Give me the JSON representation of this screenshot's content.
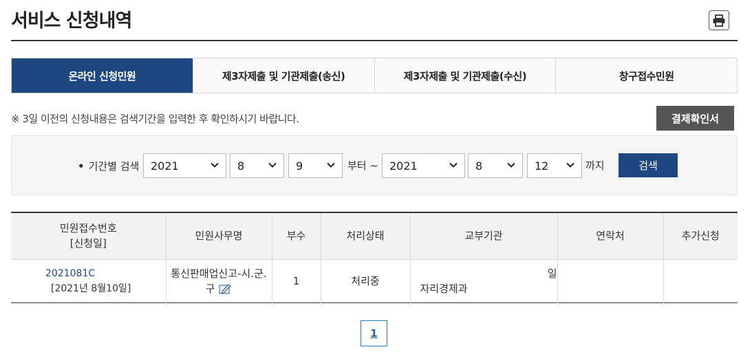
{
  "page": {
    "title": "서비스 신청내역",
    "print_icon": "printer-icon"
  },
  "tabs": [
    {
      "label": "온라인 신청민원",
      "active": true
    },
    {
      "label": "제3자제출 및 기관제출(송신)",
      "active": false
    },
    {
      "label": "제3자제출 및 기관제출(수신)",
      "active": false
    },
    {
      "label": "창구접수민원",
      "active": false
    }
  ],
  "notice": "※ 3일 이전의 신청내용은 검색기간을 입력한 후 확인하시기 바랍니다.",
  "confirm_button": "결제확인서",
  "search": {
    "label": "기간별 검색",
    "from_year": "2021",
    "from_month": "8",
    "from_day": "9",
    "from_word": "부터 ~",
    "to_year": "2021",
    "to_month": "8",
    "to_day": "12",
    "to_word": "까지",
    "button": "검색"
  },
  "table": {
    "headers": {
      "receipt_no": "민원접수번호",
      "receipt_date": "[신청일]",
      "name": "민원사무명",
      "copies": "부수",
      "status": "처리상태",
      "agency": "교부기관",
      "contact": "연락처",
      "additional": "추가신청"
    },
    "rows": [
      {
        "receipt_no": "2021081C",
        "date": "[2021년 8월10일]",
        "name_line1": "통신판매업신고-시.군.",
        "name_line2": "구",
        "attach_icon": "edit-document-icon",
        "copies": "1",
        "status": "처리중",
        "agency_line1": "일",
        "agency_line2": "자리경제과",
        "contact": "",
        "additional": ""
      }
    ]
  },
  "pagination": {
    "current": "1"
  },
  "colors": {
    "primary": "#1e4680",
    "dark_button": "#555555",
    "pager_border": "#2b7bbf"
  }
}
